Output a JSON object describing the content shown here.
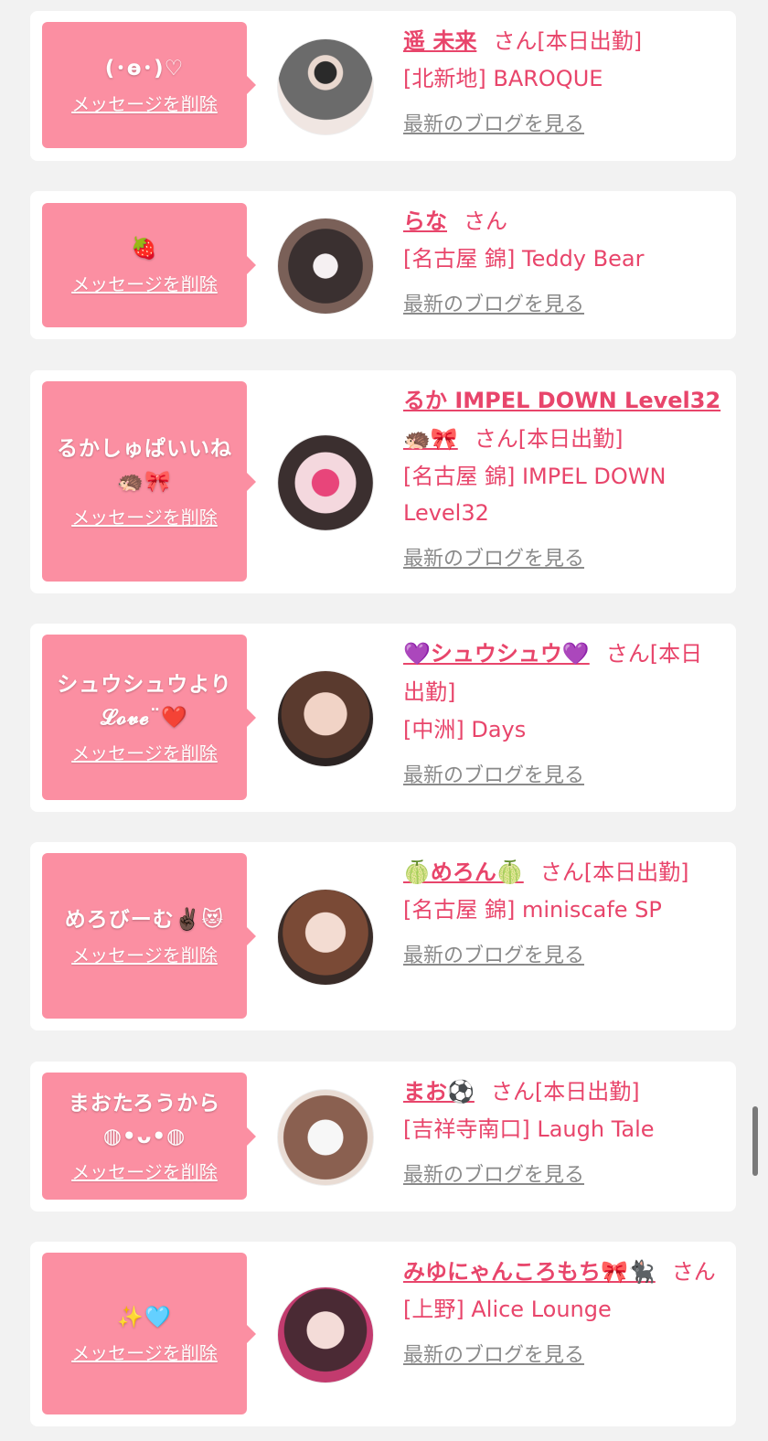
{
  "cards": [
    {
      "message": "(･ө･)♡",
      "delete_label": "メッセージを削除",
      "name": "遥 未来",
      "suffix": "さん[本日出勤]",
      "shop": "[北新地] BAROQUE",
      "blog_label": "最新のブログを見る"
    },
    {
      "message": "🍓",
      "delete_label": "メッセージを削除",
      "name": "らな",
      "suffix": "さん",
      "shop": "[名古屋 錦] Teddy Bear",
      "blog_label": "最新のブログを見る"
    },
    {
      "message": "るかしゅぱいいね🦔🎀",
      "delete_label": "メッセージを削除",
      "name": "るか IMPEL DOWN Level32 🦔🎀",
      "suffix": "さん[本日出勤]",
      "shop": "[名古屋 錦] IMPEL DOWN Level32",
      "blog_label": "最新のブログを見る"
    },
    {
      "message": "シュウシュウより 𝓛𝓸𝓿𝓮¨❤️",
      "delete_label": "メッセージを削除",
      "name": "💜シュウシュウ💜",
      "suffix": "さん[本日出勤]",
      "shop": "[中洲] Days",
      "blog_label": "最新のブログを見る"
    },
    {
      "message": "めろびーむ✌🏿😻",
      "delete_label": "メッセージを削除",
      "name": "🍈めろん🍈",
      "suffix": "さん[本日出勤]",
      "shop": "[名古屋 錦] miniscafe SP",
      "blog_label": "最新のブログを見る"
    },
    {
      "message": "まおたろうから ◍•ᴗ•◍",
      "delete_label": "メッセージを削除",
      "name": "まお⚽️",
      "suffix": "さん[本日出勤]",
      "shop": "[吉祥寺南口] Laugh Tale",
      "blog_label": "最新のブログを見る"
    },
    {
      "message": "✨🩵",
      "delete_label": "メッセージを削除",
      "name": "みゆにゃんころもち🎀🐈‍⬛",
      "suffix": "さん",
      "shop": "[上野] Alice Lounge",
      "blog_label": "最新のブログを見る"
    }
  ]
}
